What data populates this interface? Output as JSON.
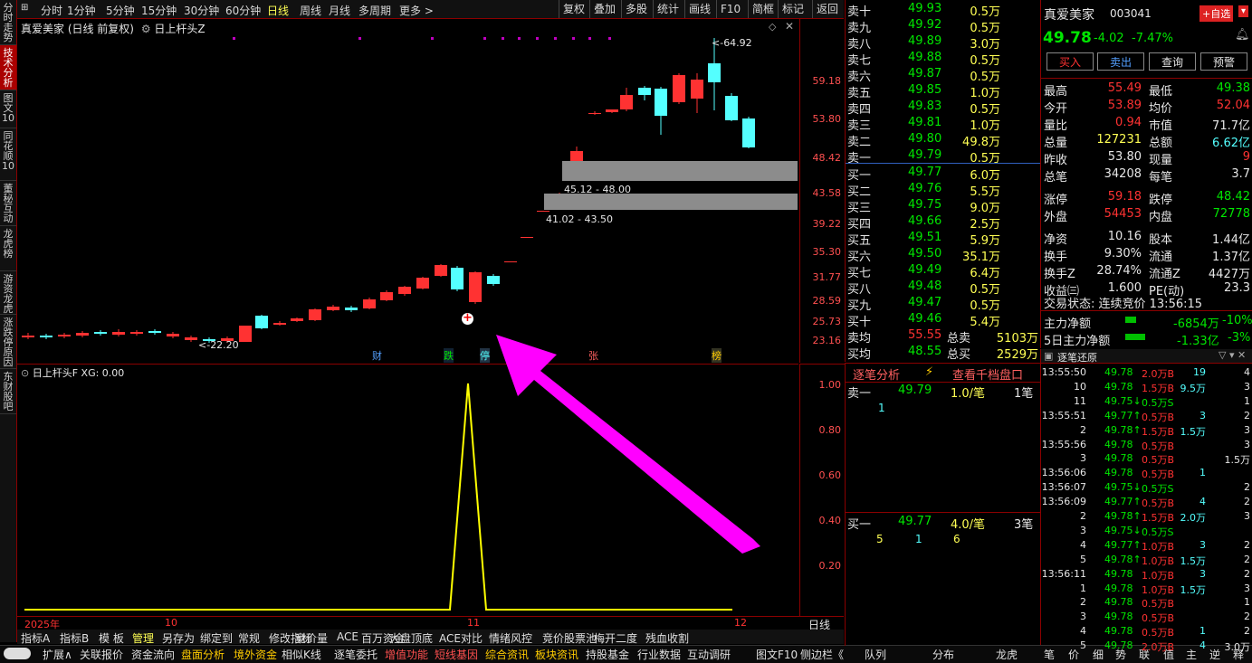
{
  "left_tabs": [
    "分时走势",
    "技术分析",
    "图文10",
    "同花顺10",
    "董秘互动",
    "龙虎榜",
    "游资龙虎",
    "涨跌停原因",
    "东财股吧"
  ],
  "toolbar": {
    "periods": [
      "分时",
      "1分钟",
      "5分钟",
      "15分钟",
      "30分钟",
      "60分钟",
      "日线",
      "周线",
      "月线",
      "多周期",
      "更多 >"
    ],
    "selected_period": "日线",
    "right_buttons": [
      "复权",
      "叠加",
      "多股",
      "统计",
      "画线",
      "F10",
      "简框",
      "标记",
      "返回"
    ]
  },
  "chart_header": {
    "stock_title": "真爱美家 (日线 前复权)",
    "indicator": "日上杆头Z"
  },
  "annotations": {
    "high_label": "64.92",
    "low_label": "22.20",
    "gap1_label": "45.12 - 48.00",
    "gap2_label": "41.02 - 43.50",
    "event_tags": [
      "财",
      "跌",
      "停",
      "张",
      "榜"
    ]
  },
  "y_axis_labels": [
    "59.18",
    "53.80",
    "48.42",
    "43.58",
    "39.22",
    "35.30",
    "31.77",
    "28.59",
    "25.73",
    "23.16"
  ],
  "sub_chart": {
    "title": "日上杆头F  XG: 0.00",
    "y_labels": [
      "1.00",
      "0.80",
      "0.60",
      "0.40",
      "0.20"
    ]
  },
  "x_axis": {
    "labels": [
      "2025年",
      "10",
      "11",
      "12"
    ],
    "period_label": "日线"
  },
  "bottom_tabs_1": [
    "指标A",
    "指标B",
    "模 板",
    "管理",
    "另存为",
    "绑定到",
    "常规",
    "修改指标",
    "竞价量",
    "ACE",
    "百万资金",
    "大盘顶底",
    "ACE对比",
    "情绪风控",
    "竞价股票池",
    "梅开二度",
    "残血收割"
  ],
  "bottom_tabs_2": [
    "扩展∧",
    "关联报价",
    "资金流向",
    "盘面分析",
    "境外资金",
    "相似K线",
    "逐笔委托",
    "增值功能",
    "短线基因",
    "综合资讯",
    "板块资讯",
    "持股基金",
    "行业数据",
    "互动调研"
  ],
  "bottom_right_tabs": [
    "图文F10",
    "侧边栏《",
    "队列",
    "分布",
    "龙虎",
    "笔",
    "价",
    "细",
    "势",
    "联",
    "值",
    "主",
    "逆",
    "释"
  ],
  "order_book": {
    "asks": [
      {
        "label": "卖十",
        "price": "49.93",
        "vol": "0.5万"
      },
      {
        "label": "卖九",
        "price": "49.92",
        "vol": "0.5万"
      },
      {
        "label": "卖八",
        "price": "49.89",
        "vol": "3.0万"
      },
      {
        "label": "卖七",
        "price": "49.88",
        "vol": "0.5万"
      },
      {
        "label": "卖六",
        "price": "49.87",
        "vol": "0.5万"
      },
      {
        "label": "卖五",
        "price": "49.85",
        "vol": "1.0万"
      },
      {
        "label": "卖四",
        "price": "49.83",
        "vol": "0.5万"
      },
      {
        "label": "卖三",
        "price": "49.81",
        "vol": "1.0万"
      },
      {
        "label": "卖二",
        "price": "49.80",
        "vol": "49.8万"
      },
      {
        "label": "卖一",
        "price": "49.79",
        "vol": "0.5万"
      }
    ],
    "bids": [
      {
        "label": "买一",
        "price": "49.77",
        "vol": "6.0万"
      },
      {
        "label": "买二",
        "price": "49.76",
        "vol": "5.5万"
      },
      {
        "label": "买三",
        "price": "49.75",
        "vol": "9.0万"
      },
      {
        "label": "买四",
        "price": "49.66",
        "vol": "2.5万"
      },
      {
        "label": "买五",
        "price": "49.51",
        "vol": "5.9万"
      },
      {
        "label": "买六",
        "price": "49.50",
        "vol": "35.1万"
      },
      {
        "label": "买七",
        "price": "49.49",
        "vol": "6.4万"
      },
      {
        "label": "买八",
        "price": "49.48",
        "vol": "0.5万"
      },
      {
        "label": "买九",
        "price": "49.47",
        "vol": "0.5万"
      },
      {
        "label": "买十",
        "price": "49.46",
        "vol": "5.4万"
      }
    ],
    "ask_avg": {
      "label": "卖均",
      "value": "55.55",
      "total_label": "总卖",
      "total": "5103万"
    },
    "bid_avg": {
      "label": "买均",
      "value": "48.55",
      "total_label": "总买",
      "total": "2529万"
    }
  },
  "quote": {
    "name": "真爱美家",
    "code": "003041",
    "add_fav": "+自选",
    "price": "49.78",
    "change": "-4.02",
    "pct": "-7.47%",
    "buttons": [
      "买入",
      "卖出",
      "查询",
      "预警"
    ],
    "rows": [
      [
        "最高",
        "55.49",
        "最低",
        "49.38"
      ],
      [
        "今开",
        "53.89",
        "均价",
        "52.04"
      ],
      [
        "量比",
        "0.94",
        "市值",
        "71.7亿"
      ],
      [
        "总量",
        "127231",
        "总额",
        "6.62亿"
      ],
      [
        "昨收",
        "53.80",
        "现量",
        "9"
      ],
      [
        "总笔",
        "34208",
        "每笔",
        "3.7"
      ],
      [
        "涨停",
        "59.18",
        "跌停",
        "48.42"
      ],
      [
        "外盘",
        "54453",
        "内盘",
        "72778"
      ],
      [
        "净资",
        "10.16",
        "股本",
        "1.44亿"
      ],
      [
        "换手",
        "9.30%",
        "流通",
        "1.37亿"
      ],
      [
        "换手Z",
        "28.74%",
        "流通Z",
        "4427万"
      ],
      [
        "收益㈢",
        "1.600",
        "PE(动)",
        "23.3"
      ]
    ],
    "status": "交易状态: 连续竞价 13:56:15",
    "main_flow": {
      "label": "主力净额",
      "value": "-6854万",
      "pct": "-10%"
    },
    "flow5": {
      "label": "5日主力净额",
      "value": "-1.33亿",
      "pct": "-3%"
    }
  },
  "tick_detail": {
    "title": "逐笔分析",
    "link": "查看千档盘口",
    "sell1": {
      "label": "卖一",
      "price": "49.79",
      "vol": "1.0/笔",
      "count": "1笔",
      "queue": [
        "1"
      ]
    },
    "buy1": {
      "label": "买一",
      "price": "49.77",
      "vol": "4.0/笔",
      "count": "3笔",
      "queue": [
        "5",
        "1",
        "6"
      ]
    }
  },
  "ticks": {
    "title": "逐笔还原",
    "rows": [
      [
        "13:55:50",
        "49.78",
        "2.0万B",
        "19",
        "4"
      ],
      [
        "10",
        "49.78",
        "1.5万B",
        "9.5万",
        "3"
      ],
      [
        "11",
        "49.75↓",
        "0.5万S",
        "",
        "1"
      ],
      [
        "13:55:51",
        "49.77↑",
        "0.5万B",
        "3",
        "2"
      ],
      [
        "2",
        "49.78↑",
        "1.5万B",
        "1.5万",
        "3"
      ],
      [
        "13:55:56",
        "49.78",
        "0.5万B",
        "",
        "3"
      ],
      [
        "3",
        "49.78",
        "0.5万B",
        "",
        "1.5万"
      ],
      [
        "13:56:06",
        "49.78",
        "0.5万B",
        "1",
        ""
      ],
      [
        "13:56:07",
        "49.75↓",
        "0.5万S",
        "",
        "2"
      ],
      [
        "13:56:09",
        "49.77↑",
        "0.5万B",
        "4",
        "2"
      ],
      [
        "2",
        "49.78↑",
        "1.5万B",
        "2.0万",
        "3"
      ],
      [
        "3",
        "49.75↓",
        "0.5万S",
        "",
        ""
      ],
      [
        "4",
        "49.77↑",
        "1.0万B",
        "3",
        "2"
      ],
      [
        "5",
        "49.78↑",
        "1.0万B",
        "1.5万",
        "2"
      ],
      [
        "13:56:11",
        "49.78",
        "1.0万B",
        "3",
        "2"
      ],
      [
        "1",
        "49.78",
        "1.0万B",
        "1.5万",
        "3"
      ],
      [
        "2",
        "49.78",
        "0.5万B",
        "",
        "1"
      ],
      [
        "3",
        "49.78",
        "0.5万B",
        "",
        "2"
      ],
      [
        "4",
        "49.78",
        "0.5万B",
        "1",
        "2"
      ],
      [
        "5",
        "49.78",
        "2.0万B",
        "4",
        "3.0万"
      ]
    ]
  },
  "colors": {
    "up": "#ff3232",
    "down": "#54ffff",
    "bg": "#000000",
    "border": "#8b0000",
    "arrow": "#ff00ff"
  }
}
